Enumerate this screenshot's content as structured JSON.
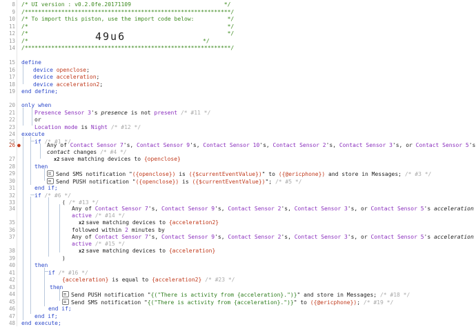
{
  "line_numbers": [
    "8",
    "9",
    "10",
    "11",
    "12",
    "13",
    "14",
    "15",
    "16",
    "17",
    "18",
    "19",
    "20",
    "21",
    "22",
    "23",
    "24",
    "25",
    "26",
    "27",
    "28",
    "29",
    "30",
    "31",
    "32",
    "33",
    "34",
    "35",
    "36",
    "37",
    "38",
    "39",
    "40",
    "41",
    "42",
    "43",
    "44",
    "45",
    "46",
    "47",
    "48",
    "49",
    "50"
  ],
  "header": {
    "l8": "/* UI version : v0.2.0fe.20171109                            */",
    "l9": "/**************************************************************/",
    "l10": "/* To import this piston, use the import code below:          */",
    "l11": "/*                                                            */",
    "l12": "/*                                                            */",
    "l13_a": "/*",
    "import_code": "49u6",
    "l13_b": "*/",
    "l14": "/**************************************************************/"
  },
  "define_block": {
    "define": "define",
    "device_kw": "device",
    "d1": "openclose",
    "d2": "acceleration",
    "d3": "acceleration2",
    "semicolon": ";",
    "end_define": "end define;"
  },
  "only_when": {
    "kw": "only when",
    "c1_dev": "Presence Sensor 3",
    "c1_poss": "'s ",
    "c1_attr": "presence",
    "c1_is_not": " is not ",
    "c1_val": "present",
    "c1_cmt": "/* #11 */",
    "or": "or",
    "c2_subj": "Location mode",
    "c2_is": " is ",
    "c2_val": "Night",
    "c2_cmt": "/* #12 */"
  },
  "execute": {
    "execute": "execute",
    "if": "if",
    "if1_cmt": "/* #1 */",
    "any_of": "Any of ",
    "cs7": "Contact Sensor 7",
    "cs9": "Contact Sensor 9",
    "cs10": "Contact Sensor 10",
    "cs2": "Contact Sensor 2",
    "cs3": "Contact Sensor 3",
    "cs5": "Contact Sensor 5",
    "poss_comma": "'s, ",
    "poss_or": "'s, or ",
    "poss": "'s",
    "contact": "contact",
    "changes": " changes ",
    "c4_cmt": "/* #4 */",
    "save_prefix": "save matching devices to ",
    "x2": "x2",
    "v_openclose": "{openclose}",
    "then": "then",
    "sms1_a": "Send SMS notification \"",
    "sms1_b": "{openclose}",
    "sms1_c": " is ",
    "sms1_d": "{$currentEventValue}",
    "sms1_e": "\" to ",
    "sms1_f": "{@ericphone}",
    "sms1_g": " and store in Messages;",
    "c3_cmt": "/* #3 */",
    "push1_a": "Send PUSH notification \"",
    "push1_e": "\";",
    "c5_cmt": "/* #5 */",
    "end_if": "end if;",
    "if2_cmt": "/* #6 */",
    "open_paren": "(",
    "c13_cmt": "/* #13 */",
    "acceleration": "acceleration",
    "is": " is",
    "active": "active",
    "c14_cmt": "/* #14 */",
    "v_acceleration2": "{acceleration2}",
    "followed": "followed within ",
    "two": "2",
    "minutes_by": " minutes by",
    "c15_cmt": "/* #15 */",
    "v_acceleration": "{acceleration}",
    "close_paren": ")",
    "if3_cmt": "/* #16 */",
    "eq_mid": " is equal to ",
    "c23_cmt": "/* #23 */",
    "push2_a": "Send PUSH notification \"",
    "push2_b": "{(\"There is activity from {acceleration}.\")}",
    "push2_c": "\" and store in Messages;",
    "c18_cmt": "/* #18 */",
    "sms2_a": "Send SMS notification \"",
    "sms2_c": "\" to ",
    "sms2_d": "{@ericphone}",
    "sms2_e": ";",
    "c19_cmt": "/* #19 */",
    "end_execute": "end execute;"
  }
}
